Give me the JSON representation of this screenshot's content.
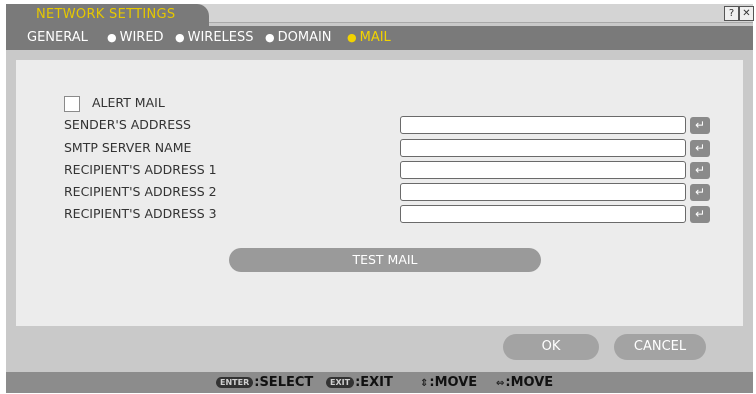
{
  "window": {
    "title": "NETWORK SETTINGS",
    "help_label": "?",
    "close_label": "✕"
  },
  "tabs": [
    {
      "label": "GENERAL",
      "active": false
    },
    {
      "label": "WIRED",
      "active": false
    },
    {
      "label": "WIRELESS",
      "active": false
    },
    {
      "label": "DOMAIN",
      "active": false
    },
    {
      "label": "MAIL",
      "active": true
    }
  ],
  "tab_separator": "●",
  "mail": {
    "alert_mail": {
      "label": "ALERT MAIL",
      "checked": false
    },
    "fields": [
      {
        "label": "SENDER'S ADDRESS",
        "value": ""
      },
      {
        "label": "SMTP SERVER NAME",
        "value": ""
      },
      {
        "label": "RECIPIENT'S ADDRESS 1",
        "value": ""
      },
      {
        "label": "RECIPIENT'S ADDRESS 2",
        "value": ""
      },
      {
        "label": "RECIPIENT'S ADDRESS 3",
        "value": ""
      }
    ],
    "enter_glyph": "↵",
    "test_mail_label": "TEST MAIL"
  },
  "actions": {
    "ok_label": "OK",
    "cancel_label": "CANCEL"
  },
  "status_bar": {
    "enter_key": "ENTER",
    "select_text": ":SELECT",
    "exit_key": "EXIT",
    "exit_text": ":EXIT",
    "updown_glyph": "⇕",
    "move_text_1": ":MOVE",
    "leftright_glyph": "⇔",
    "move_text_2": ":MOVE"
  },
  "colors": {
    "accent_yellow": "#f2d300",
    "tab_bar": "#7a7a7a",
    "window": "#c9c9c9",
    "panel": "#ececec",
    "button": "#a3a3a3"
  }
}
